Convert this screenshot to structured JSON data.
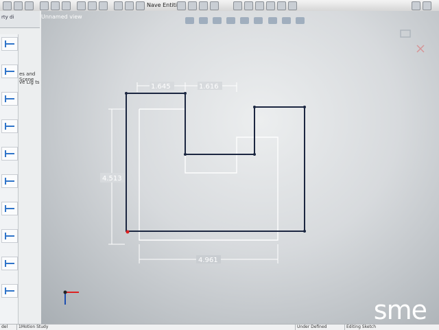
{
  "app": {
    "menu_text": "Nave Entities",
    "tree_item": "es and Scene",
    "tree_item_2": "ve Lig ts",
    "view_name": "Unnamed view"
  },
  "left": {
    "tab_label": "rty di"
  },
  "status": {
    "left1": "del",
    "left2": "1Motion Study",
    "right_text": "Under Defined",
    "right_mode": "Editing Sketch"
  },
  "dimensions": {
    "d1": "1.645",
    "d2": "1.616",
    "d3": "4.513",
    "d4": "4.961"
  },
  "logo": {
    "text": "sme"
  },
  "colors": {
    "sketch_line": "#1b2640",
    "ghost_line": "#ffffff",
    "dim_line": "#ffffff"
  }
}
